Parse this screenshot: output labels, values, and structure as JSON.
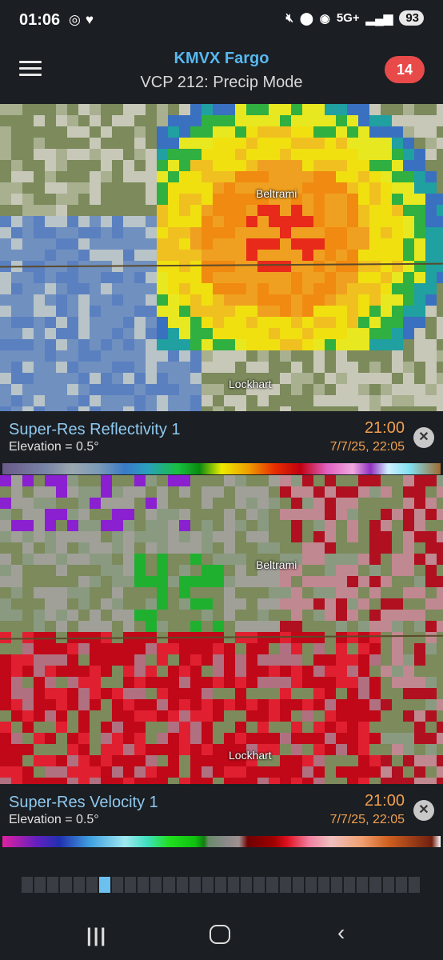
{
  "status_bar": {
    "time": "01:06",
    "left_icons": [
      "radar-icon",
      "heart-icon"
    ],
    "network": "5G+",
    "battery": "93",
    "right_icons": [
      "mute-icon",
      "location-icon",
      "hotspot-icon",
      "signal-icon",
      "battery-icon"
    ]
  },
  "header": {
    "title": "KMVX Fargo",
    "subtitle": "VCP 212: Precip Mode",
    "alert_count": "14",
    "menu_icon": "hamburger-menu-icon",
    "accent_color": "#57b8f0",
    "alert_color": "#e84a4a"
  },
  "panels": [
    {
      "product": "Super-Res Reflectivity 1",
      "elevation": "Elevation = 0.5°",
      "time": "21:00",
      "datetime": "7/7/25, 22:05",
      "labels": [
        "Beltrami",
        "Lockhart"
      ],
      "close_icon": "close-icon"
    },
    {
      "product": "Super-Res Velocity 1",
      "elevation": "Elevation = 0.5°",
      "time": "21:00",
      "datetime": "7/7/25, 22:05",
      "labels": [
        "Beltrami",
        "Lockhart"
      ],
      "close_icon": "close-icon"
    }
  ],
  "timeline": {
    "frames": 31,
    "active_frame": 6
  },
  "navbar": {
    "icons": [
      "recent-apps-icon",
      "home-icon",
      "back-icon"
    ]
  },
  "colors": {
    "time_color": "#f0a050",
    "product_color": "#8fc9f0"
  }
}
